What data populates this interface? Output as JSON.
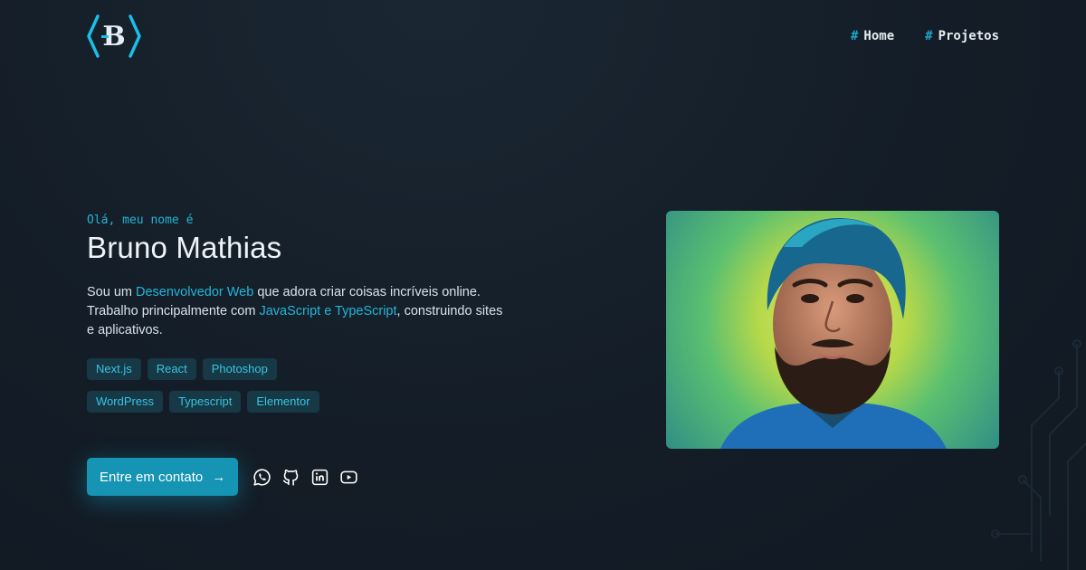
{
  "nav": {
    "items": [
      {
        "hash": "#",
        "label": "Home"
      },
      {
        "hash": "#",
        "label": "Projetos"
      }
    ]
  },
  "hero": {
    "greeting": "Olá, meu nome é",
    "name": "Bruno Mathias",
    "bio": {
      "p1": "Sou um ",
      "h1": "Desenvolvedor Web",
      "p2": " que adora criar coisas incríveis online. Trabalho principalmente com ",
      "h2": "JavaScript e TypeScript",
      "p3": ", construindo sites e aplicativos."
    },
    "tags": [
      "Next.js",
      "React",
      "Photoshop",
      "WordPress",
      "Typescript",
      "Elementor"
    ],
    "cta": {
      "label": "Entre em contato",
      "arrow": "→"
    },
    "social": [
      {
        "icon": "whatsapp-icon"
      },
      {
        "icon": "github-icon"
      },
      {
        "icon": "linkedin-icon"
      },
      {
        "icon": "youtube-icon"
      }
    ]
  },
  "colors": {
    "accent": "#19a8c9",
    "tag_bg": "#173845",
    "button": "#1594b3",
    "background": "#141d27"
  }
}
